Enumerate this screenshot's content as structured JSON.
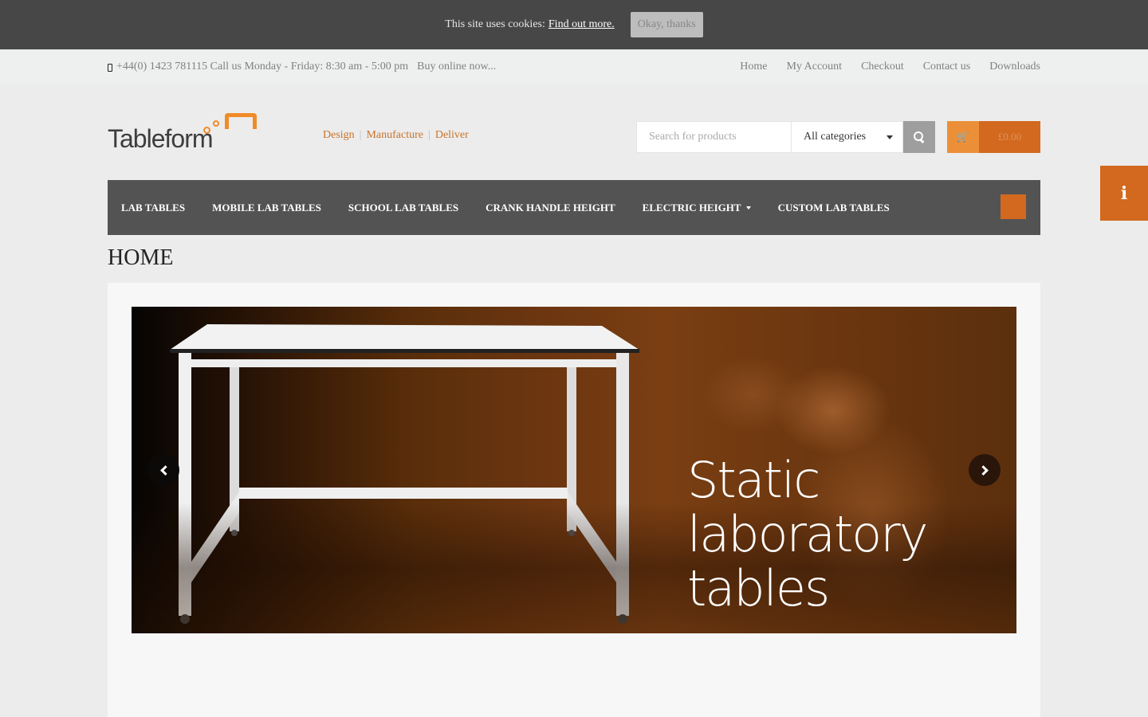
{
  "cookie_bar": {
    "message": "This site uses cookies:",
    "link_label": "Find out more.",
    "button_label": "Okay, thanks"
  },
  "topbar": {
    "phone_icon": "mobile-phone-icon",
    "phone": "+44(0) 1423 781115 Call us Monday - Friday: 8:30 am - 5:00 pm",
    "buy_online": "Buy online now...",
    "links": [
      "Home",
      "My Account",
      "Checkout",
      "Contact us",
      "Downloads"
    ]
  },
  "header": {
    "logo_text": "Tableform",
    "tagline": [
      "Design",
      "Manufacture",
      "Deliver"
    ],
    "tagline_separator": "|",
    "search_placeholder": "Search for products",
    "search_value": "",
    "category_selected": "All categories",
    "search_icon": "search-icon",
    "cart_icon": "cart-icon",
    "cart_icon_glyph": "🛒",
    "cart_total": "£0.00"
  },
  "nav": {
    "items": [
      {
        "label": "LAB TABLES",
        "has_dropdown": false
      },
      {
        "label": "MOBILE LAB TABLES",
        "has_dropdown": false
      },
      {
        "label": "SCHOOL LAB TABLES",
        "has_dropdown": false
      },
      {
        "label": "CRANK HANDLE HEIGHT",
        "has_dropdown": false
      },
      {
        "label": "ELECTRIC HEIGHT",
        "has_dropdown": true
      },
      {
        "label": "CUSTOM LAB TABLES",
        "has_dropdown": false
      }
    ]
  },
  "info_tab": {
    "glyph": "i"
  },
  "page": {
    "title": "HOME"
  },
  "slider": {
    "caption_lines": [
      "Static",
      "laboratory",
      "tables"
    ]
  },
  "colors": {
    "accent": "#d2691e",
    "accent_light": "#eb8f38",
    "nav_bg": "#535353",
    "cookie_bg": "#474747"
  }
}
